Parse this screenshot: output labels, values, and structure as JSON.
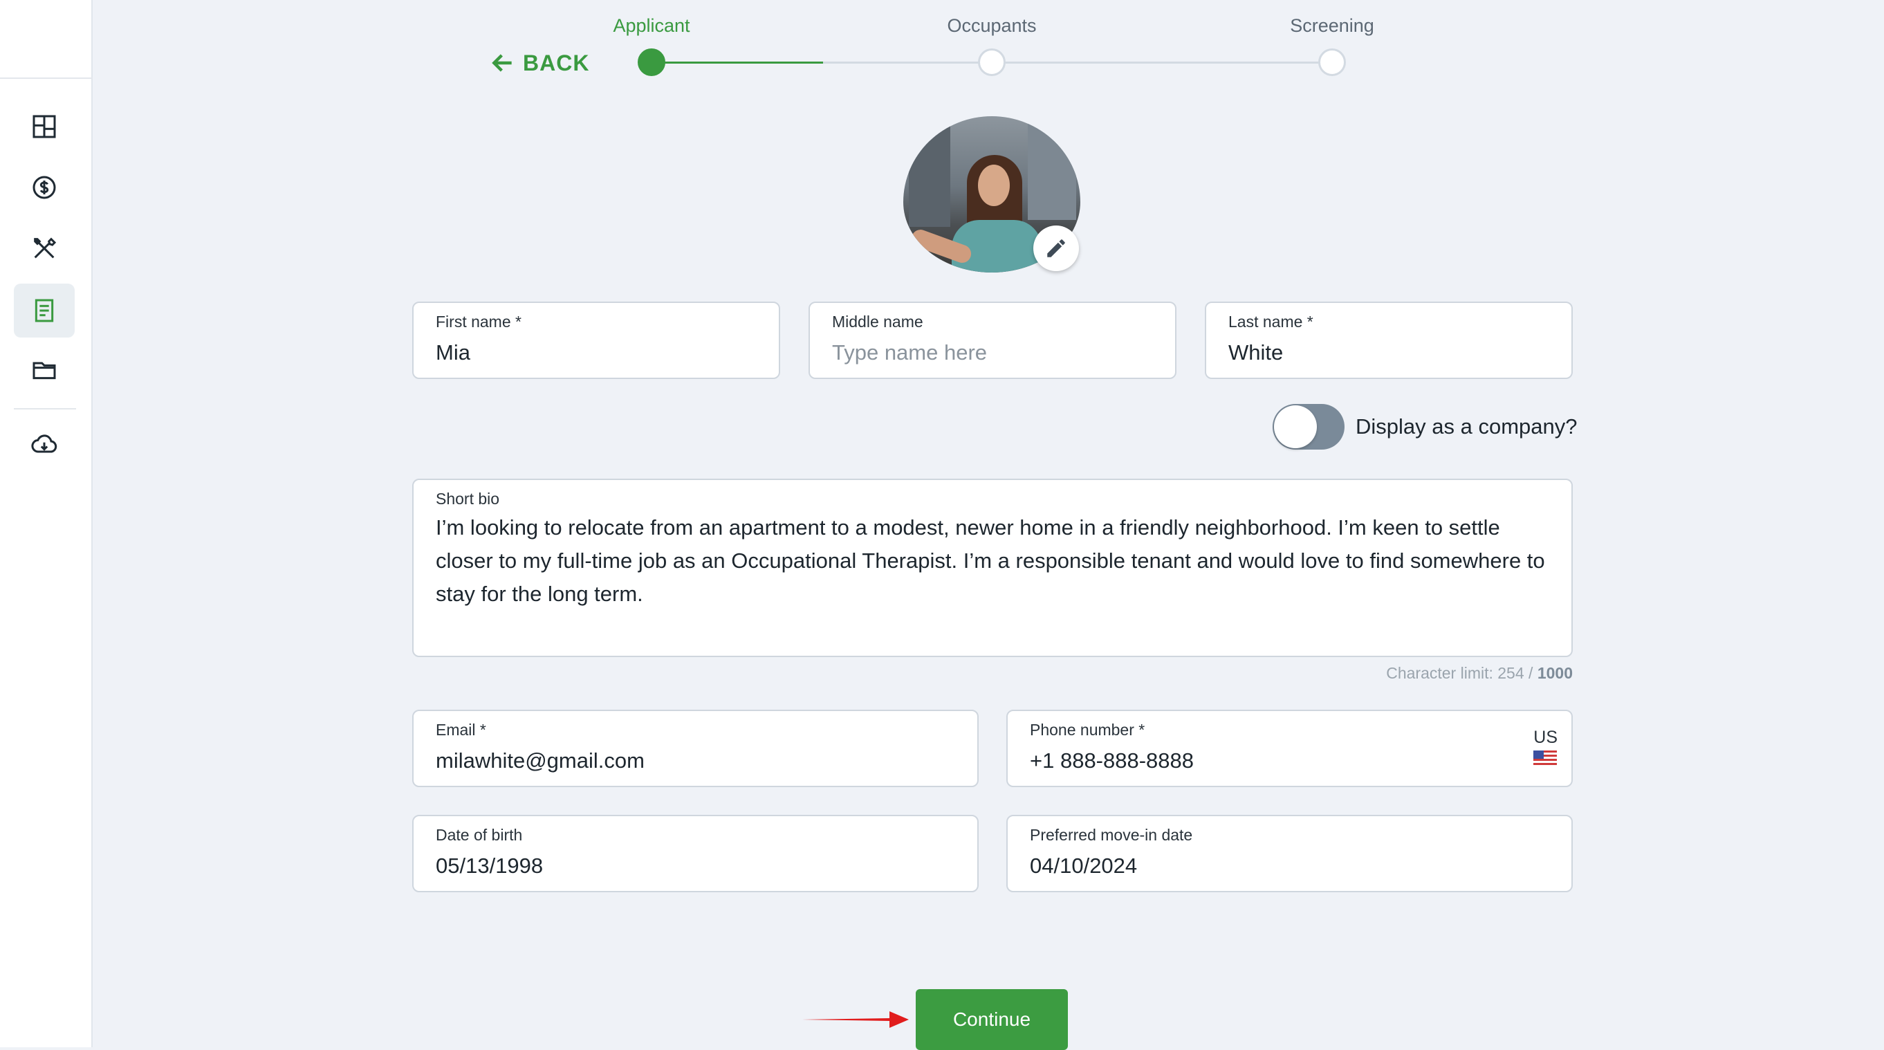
{
  "colors": {
    "accent": "#3a9a40",
    "background": "#eff2f7",
    "annotation_arrow": "#e11d1d"
  },
  "sidebar": {
    "items": [
      {
        "icon": "dashboard-icon",
        "active": false
      },
      {
        "icon": "dollar-circle-icon",
        "active": false
      },
      {
        "icon": "tools-icon",
        "active": false
      },
      {
        "icon": "document-icon",
        "active": true
      },
      {
        "icon": "folder-icon",
        "active": false
      },
      {
        "icon": "cloud-download-icon",
        "active": false
      }
    ]
  },
  "stepper": {
    "back_label": "BACK",
    "steps": [
      {
        "label": "Applicant"
      },
      {
        "label": "Occupants"
      },
      {
        "label": "Screening"
      }
    ]
  },
  "form": {
    "first_name": {
      "label": "First name *",
      "value": "Mia"
    },
    "middle_name": {
      "label": "Middle name",
      "placeholder": "Type name here"
    },
    "last_name": {
      "label": "Last name *",
      "value": "White"
    },
    "company_toggle": {
      "label": "Display as a company?",
      "on": false
    },
    "bio": {
      "label": "Short bio",
      "value": "I’m looking to relocate from an apartment to a modest, newer home in a friendly neighborhood. I’m keen to settle closer to my full-time job as an Occupational Therapist. I’m a responsible tenant and would love to find somewhere to stay for the long term.",
      "limit_prefix": "Character limit: 254 / ",
      "limit_max": "1000"
    },
    "email": {
      "label": "Email *",
      "value": "milawhite@gmail.com"
    },
    "phone": {
      "label": "Phone number *",
      "value": "+1 888-888-8888",
      "country": "US"
    },
    "dob": {
      "label": "Date of birth",
      "value": "05/13/1998"
    },
    "move_in": {
      "label": "Preferred move-in date",
      "value": "04/10/2024"
    }
  },
  "continue_label": "Continue"
}
